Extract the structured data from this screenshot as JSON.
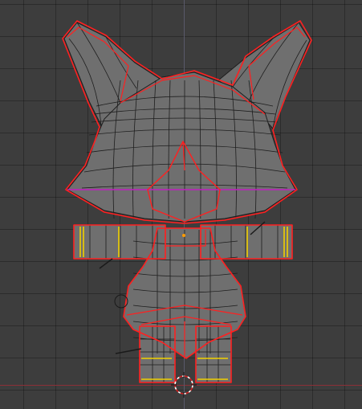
{
  "app": "3D viewport",
  "viewport": {
    "background": "#3d3d3d",
    "grid_color": "#2f2f2f",
    "x_axis_color": "#8c2f37",
    "y_axis_color": "#5a5a6a"
  },
  "object": {
    "name": "cartoon-cat-model",
    "mode": "edit",
    "mesh_fill": "#6f6f6f",
    "mesh_fill_dark": "#555555",
    "wire_color": "#1e1e1e",
    "selection_outline_color": "#ff2020",
    "seam_color": "#c01fc0",
    "yellow_edge_color": "#f0d000",
    "cursor_color": "#ffffff"
  }
}
